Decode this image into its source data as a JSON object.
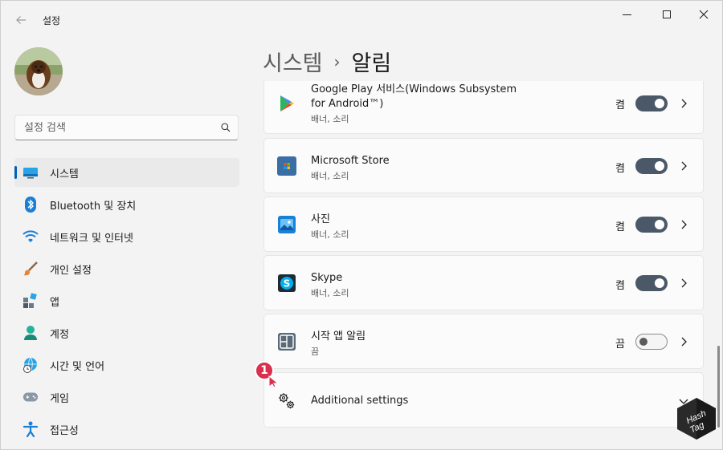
{
  "titlebar": {
    "back_icon": "back-arrow-icon",
    "title": "설정"
  },
  "search": {
    "placeholder": "설정 검색",
    "icon": "search-icon"
  },
  "breadcrumb": {
    "parent": "시스템",
    "separator": "›",
    "current": "알림"
  },
  "sidebar": {
    "items": [
      {
        "label": "시스템",
        "icon": "monitor-icon",
        "selected": true
      },
      {
        "label": "Bluetooth 및 장치",
        "icon": "bluetooth-icon"
      },
      {
        "label": "네트워크 및 인터넷",
        "icon": "wifi-icon"
      },
      {
        "label": "개인 설정",
        "icon": "brush-icon"
      },
      {
        "label": "앱",
        "icon": "apps-icon"
      },
      {
        "label": "계정",
        "icon": "account-icon"
      },
      {
        "label": "시간 및 언어",
        "icon": "globe-clock-icon"
      },
      {
        "label": "게임",
        "icon": "gamepad-icon"
      },
      {
        "label": "접근성",
        "icon": "accessibility-icon"
      }
    ]
  },
  "apps": [
    {
      "name": "Google Play 서비스(Windows Subsystem",
      "name2": "for Android™)",
      "sub": "배너, 소리",
      "state": "켬",
      "on": true,
      "icon": "google-play-icon"
    },
    {
      "name": "Microsoft Store",
      "sub": "배너, 소리",
      "state": "켬",
      "on": true,
      "icon": "microsoft-store-icon"
    },
    {
      "name": "사진",
      "sub": "배너, 소리",
      "state": "켬",
      "on": true,
      "icon": "photos-icon"
    },
    {
      "name": "Skype",
      "sub": "배너, 소리",
      "state": "켬",
      "on": true,
      "icon": "skype-icon"
    },
    {
      "name": "시작 앱 알림",
      "sub": "끔",
      "state": "끔",
      "on": false,
      "icon": "startup-apps-icon"
    }
  ],
  "additional": {
    "label": "Additional settings",
    "icon": "gears-icon"
  },
  "annotation": {
    "badge": "1"
  },
  "logo": {
    "text1": "Hash",
    "text2": "Tag"
  },
  "colors": {
    "accent": "#005fb8",
    "toggle_on": "#4a5868",
    "badge": "#d9304d"
  }
}
